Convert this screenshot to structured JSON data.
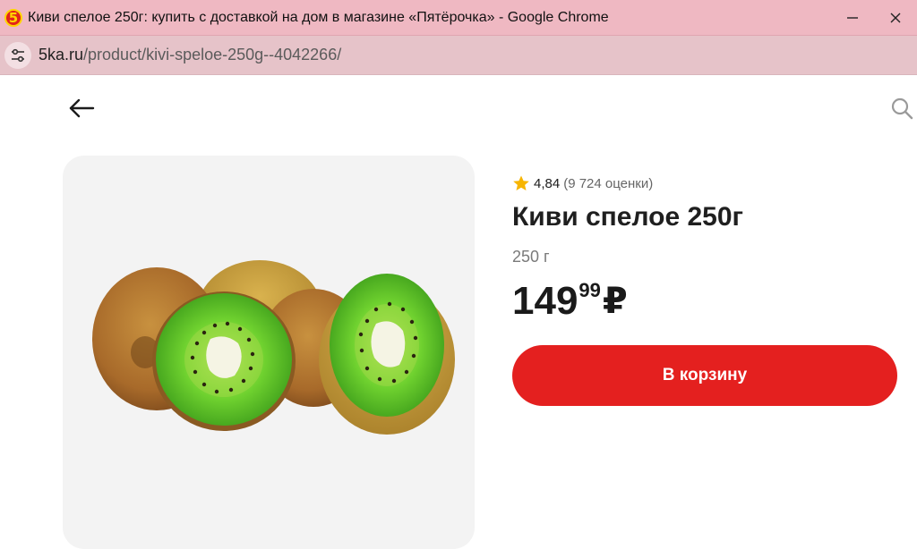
{
  "browser": {
    "window_title": "Киви спелое 250г: купить с доставкой на дом в магазине «Пятёрочка» - Google Chrome",
    "url_host": "5ka.ru",
    "url_path": "/product/kivi-speloe-250g--4042266/",
    "favicon_text": "5",
    "title_bar_color": "#efb8c2",
    "address_bar_color": "#e6c3c9"
  },
  "header": {
    "back_icon": "arrow-left-icon",
    "search_icon": "search-icon"
  },
  "product": {
    "rating": {
      "icon": "star-icon",
      "score": "4,84",
      "count": "(9 724 оценки)"
    },
    "title": "Киви спелое 250г",
    "weight": "250 г",
    "price": {
      "main": "149",
      "kopecks": "99",
      "currency": "₽"
    },
    "add_to_cart_label": "В корзину",
    "accent_color": "#e4201f",
    "image_subject": "kiwi-fruits"
  }
}
